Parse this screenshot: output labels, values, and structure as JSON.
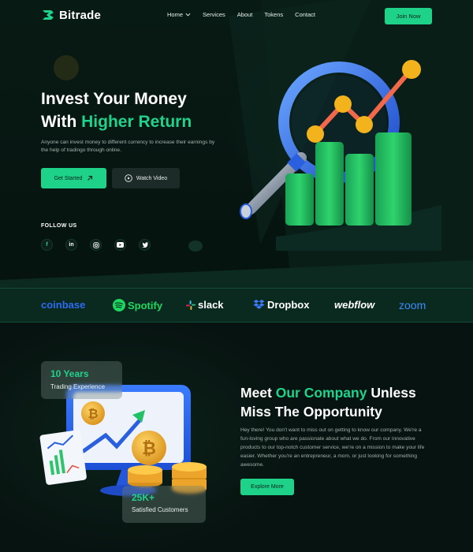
{
  "brand": {
    "name": "Bitrade"
  },
  "nav": {
    "links": [
      "Home",
      "Services",
      "About",
      "Tokens",
      "Contact"
    ],
    "cta": "Join Now"
  },
  "hero": {
    "title_line1": "Invest Your Money",
    "title_line2_prefix": "With ",
    "title_line2_accent": "Higher Return",
    "description": "Anyone can invest money to different currency to increase their earnings by the help of tradingo through online.",
    "primary_button": "Get Started",
    "secondary_button": "Watch Video",
    "follow_label": "FOLLOW US",
    "socials": [
      "facebook-icon",
      "linkedin-icon",
      "instagram-icon",
      "youtube-icon",
      "twitter-icon"
    ]
  },
  "partners": [
    "coinbase",
    "Spotify",
    "slack",
    "Dropbox",
    "webflow",
    "zoom"
  ],
  "about": {
    "title_prefix": "Meet ",
    "title_accent": "Our Company",
    "title_suffix": " Unless",
    "title_line2": "Miss The Opportunity",
    "description": "Hey there! You don't want to miss out on getting to know our company. We're a fun-loving group who are passionate about what we do. From our innovative products to our top-notch customer service, we're on a mission to make your life easier. Whether you're an entrepreneur, a mom, or just looking for something awesome.",
    "button": "Explore More",
    "stat1": {
      "value": "10 Years",
      "label": "Trading Experience"
    },
    "stat2": {
      "value": "25K+",
      "label": "Satisfied Customers"
    }
  },
  "colors": {
    "accent": "#1fd38c",
    "background": "#07130f",
    "brand_strip": "#0a2a20"
  }
}
